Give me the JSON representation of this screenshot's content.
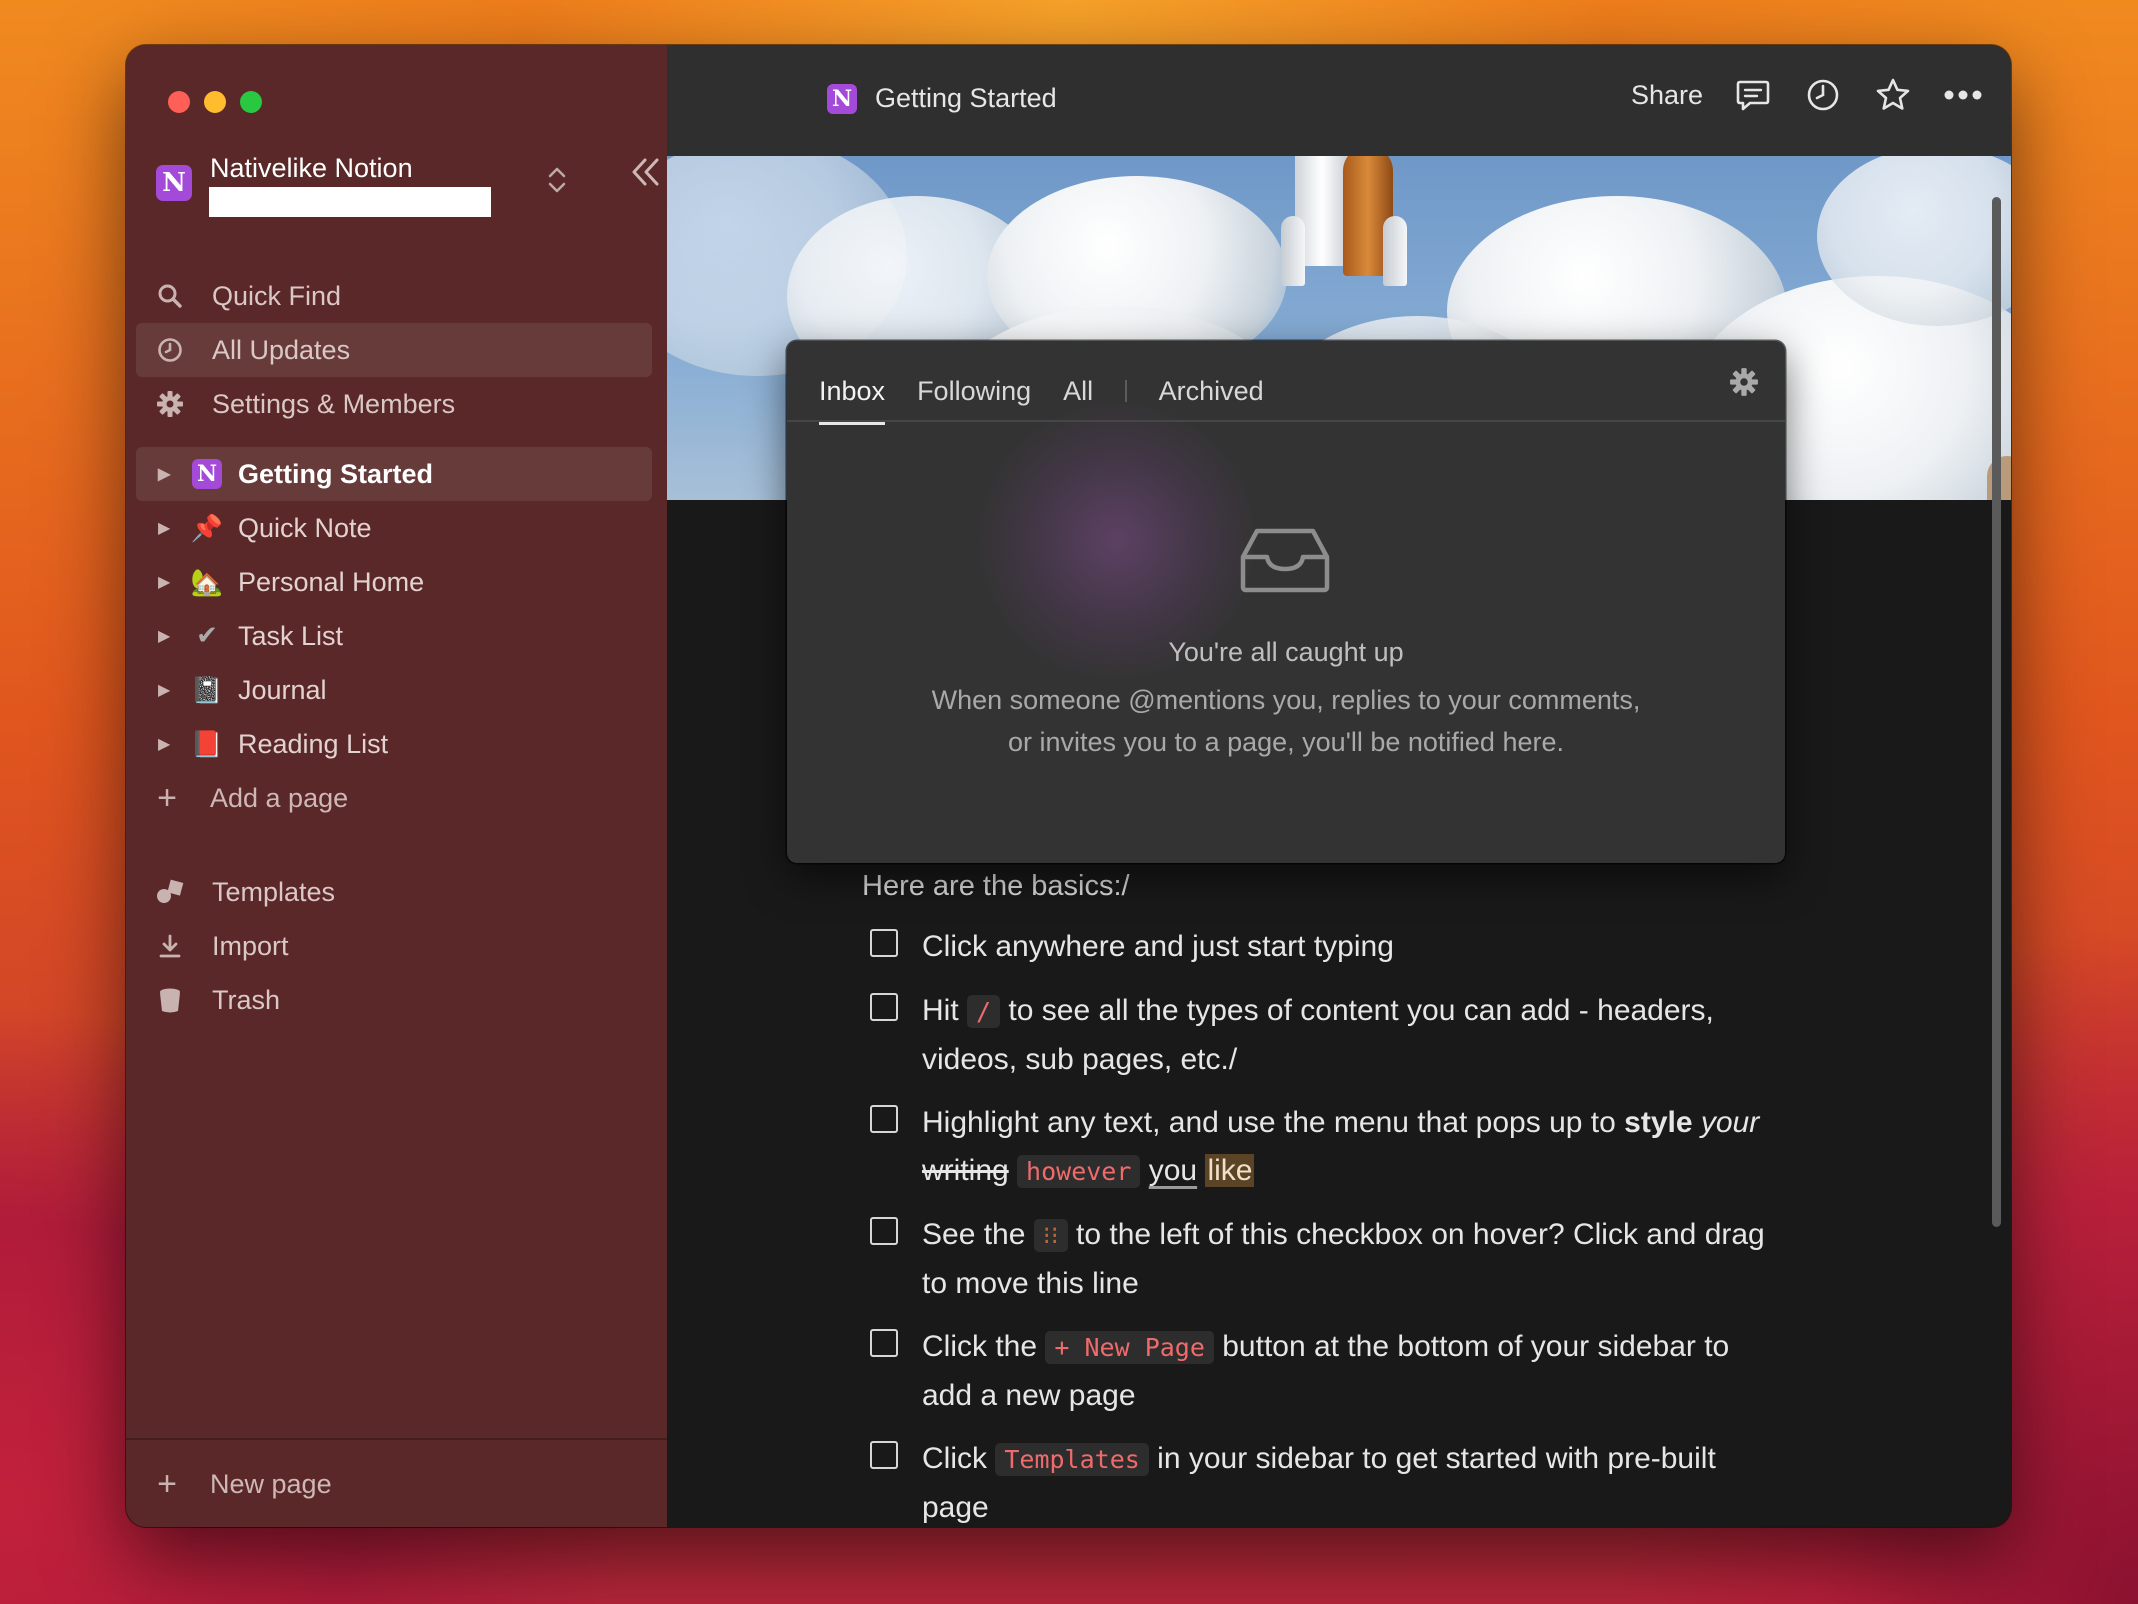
{
  "workspace": {
    "name": "Nativelike Notion",
    "logo_letter": "N"
  },
  "sidebar": {
    "nav": [
      {
        "label": "Quick Find",
        "icon": "search-icon"
      },
      {
        "label": "All Updates",
        "icon": "clock-icon"
      },
      {
        "label": "Settings & Members",
        "icon": "gear-icon"
      }
    ],
    "pages": [
      {
        "label": "Getting Started",
        "emoji": "N"
      },
      {
        "label": "Quick Note",
        "emoji": "📌"
      },
      {
        "label": "Personal Home",
        "emoji": "🏡"
      },
      {
        "label": "Task List",
        "emoji": "✔"
      },
      {
        "label": "Journal",
        "emoji": "📓"
      },
      {
        "label": "Reading List",
        "emoji": "📕"
      }
    ],
    "add_page": "Add a page",
    "bottom": [
      {
        "label": "Templates",
        "icon": "templates-icon"
      },
      {
        "label": "Import",
        "icon": "download-icon"
      },
      {
        "label": "Trash",
        "icon": "trash-icon"
      }
    ],
    "new_page": "New page"
  },
  "topbar": {
    "title": "Getting Started",
    "share": "Share",
    "icons": [
      "comment-icon",
      "history-icon",
      "star-icon",
      "more-icon"
    ]
  },
  "popup": {
    "tabs": [
      "Inbox",
      "Following",
      "All",
      "Archived"
    ],
    "active_tab": "Inbox",
    "empty_title": "You're all caught up",
    "empty_line1": "When someone @mentions you, replies to your comments,",
    "empty_line2": "or invites you to a page, you'll be notified here."
  },
  "content": {
    "basics": "Here are the basics:/",
    "todos": {
      "t1": "Click anywhere and just start typing",
      "t2_a": "Hit",
      "t2_code": "/",
      "t2_b": "to see all the types of content you can add - headers, videos, sub pages, etc./",
      "t3_a": "Highlight any text, and use the menu that pops up to",
      "t3_bold": "style",
      "t3_ital": "your",
      "t3_strike": "writing",
      "t3_code": "however",
      "t3_under": "you",
      "t3_hl": "like",
      "t4_a": "See the",
      "t4_code": "⁝⁝",
      "t4_b": "to the left of this checkbox on hover? Click and drag to move this line",
      "t5_a": "Click the",
      "t5_code": "+ New Page",
      "t5_b": "button at the bottom of your sidebar to add a new page",
      "t6_a": "Click",
      "t6_code": "Templates",
      "t6_b": "in your sidebar to get started with pre-built page"
    }
  },
  "colors": {
    "sidebar_bg": "#5a2828",
    "main_bg": "#191919",
    "popup_bg": "#333333",
    "code_text": "#ef6b6b",
    "workspace_logo": "#a44ad8"
  }
}
